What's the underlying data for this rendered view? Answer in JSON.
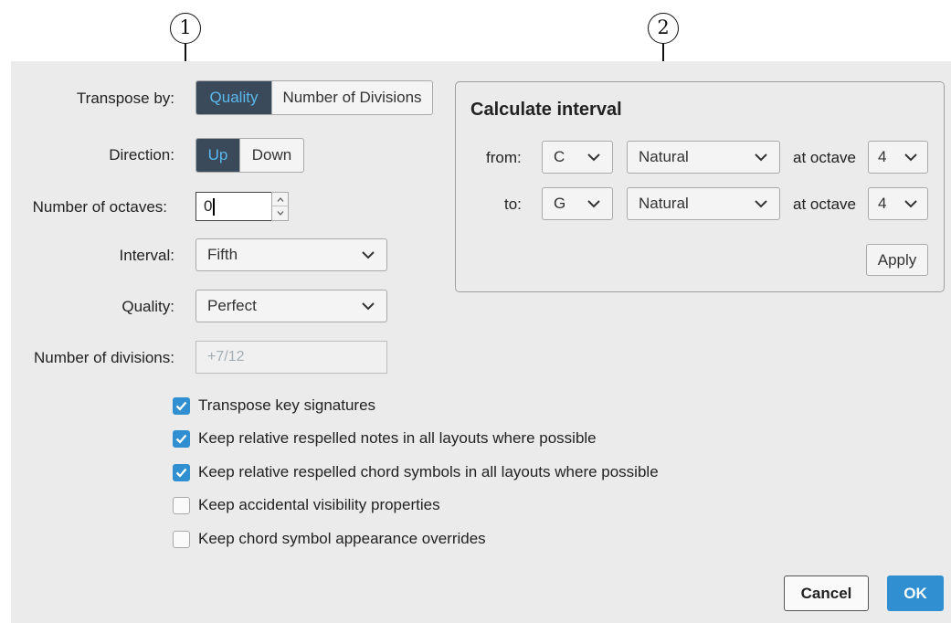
{
  "callouts": {
    "first": "1",
    "second": "2"
  },
  "transpose_by": {
    "label": "Transpose by:",
    "options": [
      "Quality",
      "Number of Divisions"
    ],
    "selected": "Quality"
  },
  "direction": {
    "label": "Direction:",
    "options": [
      "Up",
      "Down"
    ],
    "selected": "Up"
  },
  "octaves": {
    "label": "Number of octaves:",
    "value": "0"
  },
  "interval": {
    "label": "Interval:",
    "value": "Fifth"
  },
  "quality": {
    "label": "Quality:",
    "value": "Perfect"
  },
  "divisions": {
    "label": "Number of divisions:",
    "value": "+7/12"
  },
  "checkboxes": [
    {
      "label": "Transpose key signatures",
      "checked": true
    },
    {
      "label": "Keep relative respelled notes in all layouts where possible",
      "checked": true
    },
    {
      "label": "Keep relative respelled chord symbols in all layouts where possible",
      "checked": true
    },
    {
      "label": "Keep accidental visibility properties",
      "checked": false
    },
    {
      "label": "Keep chord symbol appearance overrides",
      "checked": false
    }
  ],
  "calculate_interval": {
    "title": "Calculate interval",
    "from": {
      "label": "from:",
      "note": "C",
      "accidental": "Natural",
      "octave_label": "at octave",
      "octave": "4"
    },
    "to": {
      "label": "to:",
      "note": "G",
      "accidental": "Natural",
      "octave_label": "at octave",
      "octave": "4"
    },
    "apply_label": "Apply"
  },
  "footer": {
    "cancel_label": "Cancel",
    "ok_label": "OK"
  },
  "colors": {
    "accent": "#2f8fd1",
    "segment_active_bg": "#3b4a5a",
    "segment_active_text": "#5ab8ec",
    "dialog_bg": "#ebebeb"
  },
  "icons": {
    "dropdown": "chevron-down-icon",
    "spin_up": "chevron-up-icon",
    "spin_down": "chevron-down-icon",
    "check": "checkmark-icon"
  }
}
